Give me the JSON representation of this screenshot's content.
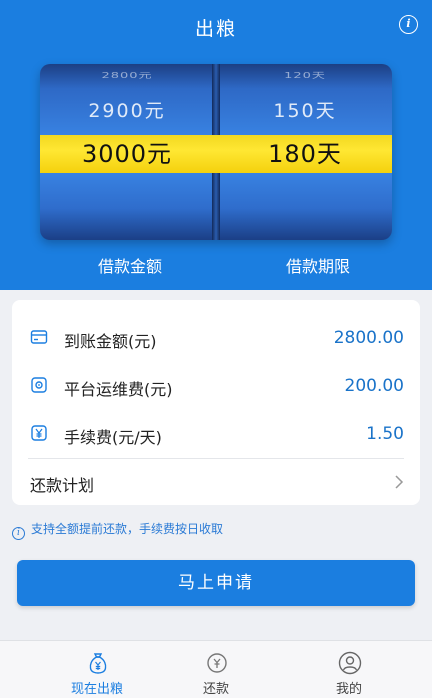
{
  "header": {
    "title": "出粮",
    "info_icon": "info-icon"
  },
  "picker": {
    "amount": {
      "far": "2800元",
      "near": "2900元",
      "selected": "3000元",
      "label": "借款金额"
    },
    "term": {
      "far": "120天",
      "near": "150天",
      "selected": "180天",
      "label": "借款期限"
    }
  },
  "details": {
    "received": {
      "label": "到账金额(元)",
      "value": "2800.00",
      "icon": "card-icon"
    },
    "platform_fee": {
      "label": "平台运维费(元)",
      "value": "200.00",
      "icon": "settings-coin-icon"
    },
    "service_fee": {
      "label": "手续费(元/天)",
      "value": "1.50",
      "icon": "yen-icon"
    },
    "plan": {
      "label": "还款计划",
      "icon": "chevron-right-icon"
    }
  },
  "notice": "支持全额提前还款，手续费按日收取",
  "apply_button": "马上申请",
  "tabs": [
    {
      "label": "现在出粮",
      "icon": "moneybag-icon",
      "active": true
    },
    {
      "label": "还款",
      "icon": "repay-icon",
      "active": false
    },
    {
      "label": "我的",
      "icon": "user-icon",
      "active": false
    }
  ],
  "colors": {
    "primary": "#1b7ee0",
    "highlight": "#ffe733",
    "value_text": "#1a73c9"
  }
}
